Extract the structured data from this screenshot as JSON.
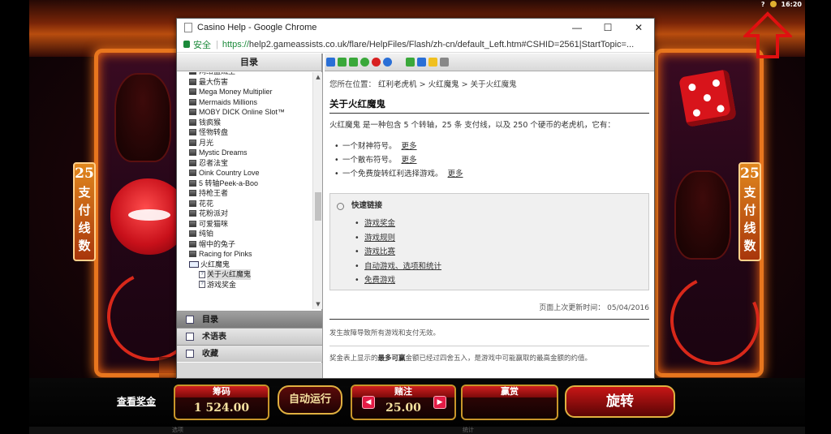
{
  "system": {
    "help_glyph": "?",
    "time": "16:20"
  },
  "game": {
    "paylines_number": "25",
    "paylines_text": [
      "支",
      "付",
      "线",
      "数"
    ],
    "view_payouts": "查看奖金",
    "coins_label": "筹码",
    "coins_value": "1 524.00",
    "autoplay_label": "自动运行",
    "bet_label": "赌注",
    "bet_value": "25.00",
    "win_label": "赢赏",
    "win_value": "",
    "spin_label": "旋转",
    "strip_left": "选项",
    "strip_right": "统计"
  },
  "window": {
    "title": "Casino Help - Google Chrome",
    "min": "—",
    "max": "☐",
    "close": "✕",
    "secure_label": "安全",
    "url_scheme": "https://",
    "url_rest": "help2.gameassists.co.uk/flare/HelpFiles/Flash/zh-cn/default_Left.htm#CSHID=2561|StartTopic=..."
  },
  "toc": {
    "header": "目录",
    "items": [
      {
        "kind": "book",
        "label": "网络盗贼王"
      },
      {
        "kind": "book",
        "label": "最大伤害"
      },
      {
        "kind": "book",
        "label": "Mega Money Multiplier"
      },
      {
        "kind": "book",
        "label": "Mermaids Millions"
      },
      {
        "kind": "book",
        "label": "MOBY DICK Online Slot™"
      },
      {
        "kind": "book",
        "label": "钱疯猴"
      },
      {
        "kind": "book",
        "label": "怪物转盘"
      },
      {
        "kind": "book",
        "label": "月光"
      },
      {
        "kind": "book",
        "label": "Mystic Dreams"
      },
      {
        "kind": "book",
        "label": "忍者法宝"
      },
      {
        "kind": "book",
        "label": "Oink Country Love"
      },
      {
        "kind": "book",
        "label": "5 转轴Peek-a-Boo"
      },
      {
        "kind": "book",
        "label": "持枪王者"
      },
      {
        "kind": "book",
        "label": "花花"
      },
      {
        "kind": "book",
        "label": "花粉派对"
      },
      {
        "kind": "book",
        "label": "可爱猫咪"
      },
      {
        "kind": "book",
        "label": "纯铂"
      },
      {
        "kind": "book",
        "label": "帽中的兔子"
      },
      {
        "kind": "book",
        "label": "Racing for Pinks"
      },
      {
        "kind": "open",
        "label": "火红魔鬼"
      },
      {
        "kind": "doc",
        "label": "关于火红魔鬼",
        "selected": true
      },
      {
        "kind": "doc",
        "label": "游戏奖金"
      }
    ],
    "scroll_up": "▲",
    "scroll_down": "▼",
    "tabs": [
      "目录",
      "术语表",
      "收藏"
    ]
  },
  "content": {
    "breadcrumb_prefix": "您所在位置：",
    "breadcrumb": [
      "红利老虎机",
      "火红魔鬼",
      "关于火红魔鬼"
    ],
    "breadcrumb_sep": " > ",
    "title": "关于火红魔鬼",
    "intro": "火红魔鬼 是一种包含 5 个转轴，25 条 支付线，以及 250 个硬币的老虎机，它有：",
    "bullets": [
      "一个财神符号。",
      "一个散布符号。",
      "一个免费旋转红利选择游戏。"
    ],
    "more_label": "更多",
    "quick_links_title": "快速链接",
    "quick_links": [
      "游戏奖金",
      "游戏规则",
      "游戏比赛",
      "自动游戏、选项和统计",
      "免费游戏"
    ],
    "updated": "页面上次更新时间： 05/04/2016",
    "note1": "发生故障导致所有游戏和支付无效。",
    "note2_a": "奖金表上显示的",
    "note2_b": "最多可赢",
    "note2_c": "金额已经过四舍五入，是游戏中可能赢取的最高金额的约值。"
  }
}
